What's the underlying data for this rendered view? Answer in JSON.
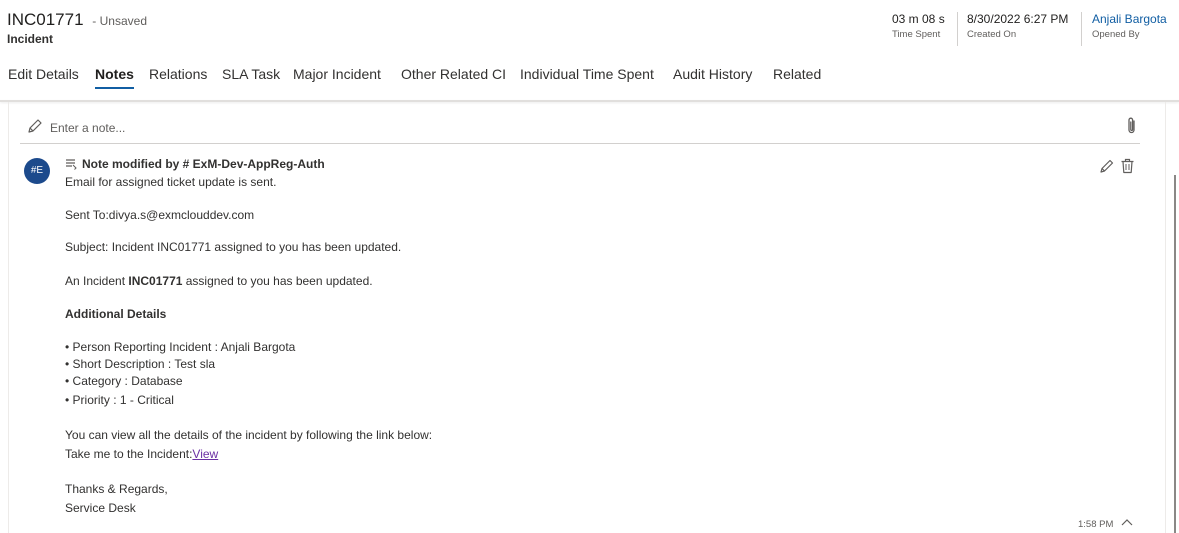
{
  "record": {
    "number": "INC01771",
    "unsaved": "- Unsaved",
    "entity": "Incident"
  },
  "header_fields": {
    "time_spent": {
      "value": "03 m 08 s",
      "label": "Time Spent"
    },
    "created_on": {
      "value": "8/30/2022 6:27 PM",
      "label": "Created On"
    },
    "opened_by": {
      "value": "Anjali Bargota",
      "label": "Opened By"
    }
  },
  "tabs": [
    {
      "label": "Edit Details",
      "active": false
    },
    {
      "label": "Notes",
      "active": true
    },
    {
      "label": "Relations",
      "active": false
    },
    {
      "label": "SLA Task",
      "active": false
    },
    {
      "label": "Major Incident",
      "active": false
    },
    {
      "label": "Other Related CI",
      "active": false
    },
    {
      "label": "Individual Time Spent",
      "active": false
    },
    {
      "label": "Audit History",
      "active": false
    },
    {
      "label": "Related",
      "active": false
    }
  ],
  "note_input": {
    "placeholder": "Enter a note..."
  },
  "note": {
    "avatar_initials": "#E",
    "header": "Note modified by # ExM-Dev-AppReg-Auth",
    "line1": "Email for assigned ticket update is sent.",
    "sent_to": "Sent To:divya.s@exmclouddev.com",
    "subject": "Subject: Incident INC01771 assigned to you has been updated.",
    "intro_prefix": "An Incident ",
    "intro_incident": "INC01771",
    "intro_suffix": " assigned to you has been updated.",
    "details_heading": "Additional Details",
    "details": [
      "• Person Reporting Incident : Anjali Bargota",
      "• Short Description : Test sla",
      "• Category : Database",
      "• Priority : 1 - Critical"
    ],
    "view_all_text": "You can view all the details of the incident by following the link below:",
    "take_me_prefix": "Take me to the Incident:",
    "view_link": "View",
    "thanks": "Thanks & Regards,",
    "signature": "Service Desk",
    "timestamp": "1:58 PM"
  },
  "icons": {
    "note_input": "pencil-icon",
    "attach": "paperclip-icon",
    "note_type": "note-document-icon",
    "edit": "edit-icon",
    "delete": "trash-icon",
    "collapse": "chevron-up-icon"
  },
  "colors": {
    "accent": "#115ea3",
    "avatar": "#1c4a8c",
    "link_visited": "#6b2fa3"
  }
}
